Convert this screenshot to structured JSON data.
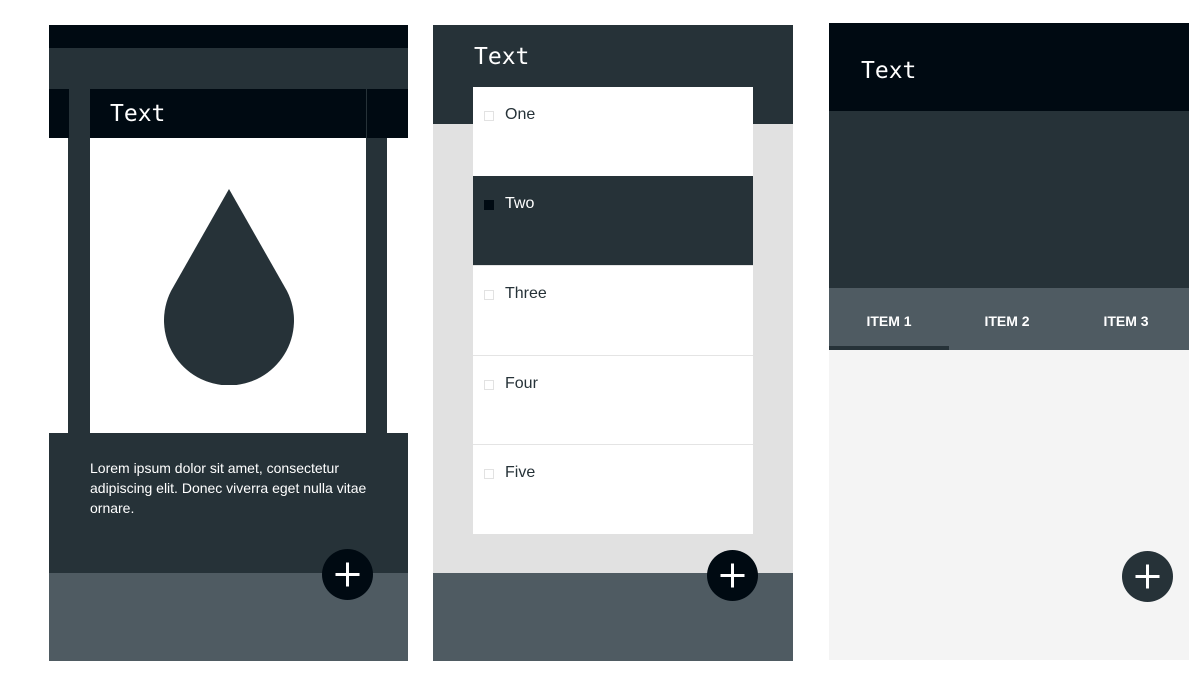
{
  "screens": [
    {
      "title": "Text",
      "body_text": "Lorem ipsum dolor sit amet, consectetur adipiscing elit. Donec viverra eget nulla vitae ornare.",
      "media_icon": "water-drop-icon",
      "fab_icon": "plus-icon"
    },
    {
      "title": "Text",
      "list_items": [
        {
          "label": "One",
          "selected": false
        },
        {
          "label": "Two",
          "selected": true
        },
        {
          "label": "Three",
          "selected": false
        },
        {
          "label": "Four",
          "selected": false
        },
        {
          "label": "Five",
          "selected": false
        }
      ],
      "fab_icon": "plus-icon"
    },
    {
      "title": "Text",
      "tabs": [
        {
          "label": "ITEM 1",
          "active": true
        },
        {
          "label": "ITEM 2",
          "active": false
        },
        {
          "label": "ITEM 3",
          "active": false
        }
      ],
      "fab_icon": "plus-icon"
    }
  ],
  "colors": {
    "primary": "#263238",
    "primary_dark": "#000a12",
    "primary_light": "#4f5b62",
    "surface": "#ffffff",
    "background_light": "#f4f4f4",
    "background_gray": "#e1e1e1"
  }
}
